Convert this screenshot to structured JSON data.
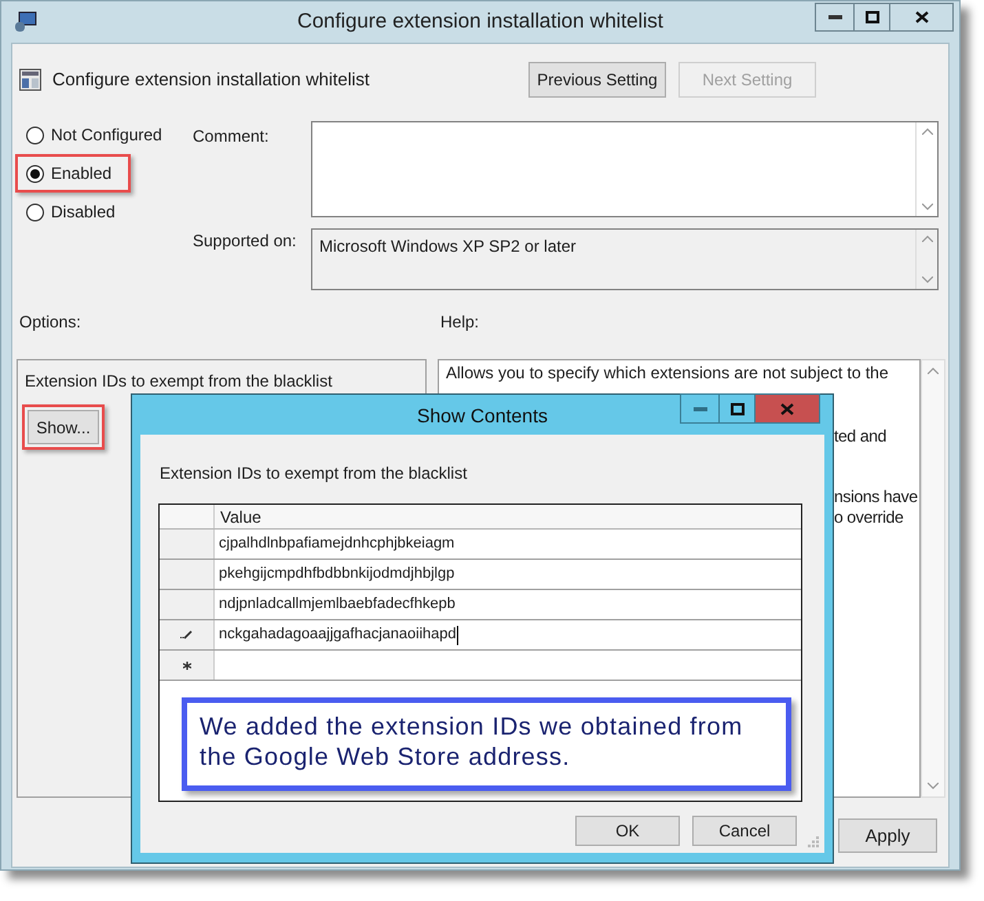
{
  "window": {
    "title": "Configure extension installation whitelist"
  },
  "policy": {
    "name": "Configure extension installation whitelist",
    "buttons": [
      {
        "label": "Previous Setting",
        "disabled": false
      },
      {
        "label": "Next Setting",
        "disabled": true
      }
    ]
  },
  "state_options": [
    {
      "label": "Not Configured",
      "selected": false,
      "highlighted": false
    },
    {
      "label": "Enabled",
      "selected": true,
      "highlighted": true
    },
    {
      "label": "Disabled",
      "selected": false,
      "highlighted": false
    }
  ],
  "comment": {
    "label": "Comment:"
  },
  "supported_on": {
    "label": "Supported on:",
    "value": "Microsoft Windows XP SP2 or later"
  },
  "options": {
    "label": "Options:",
    "text": "Extension IDs to exempt from the blacklist",
    "button": {
      "label": "Show...",
      "highlighted": true
    }
  },
  "help": {
    "label": "Help:",
    "lines": [
      {
        "text": "Allows you to specify which extensions are not subject to the",
        "cut": false
      },
      {
        "text": "ted and",
        "cut": true
      },
      {
        "text": "nsions have",
        "cut": true
      },
      {
        "text": "o override",
        "cut": true
      }
    ]
  },
  "apply_button": {
    "label": "Apply"
  },
  "dialog": {
    "title": "Show Contents",
    "label": "Extension IDs to exempt from the blacklist",
    "column": "Value",
    "rows": [
      {
        "value": "cjpalhdlnbpafiamejdnhcphjbkeiagm",
        "editing": false
      },
      {
        "value": "pkehgijcmpdhfbdbbnkijodmdjhbjlgp",
        "editing": false
      },
      {
        "value": "ndjpnladcallmjemlbaebfadecfhkepb",
        "editing": false
      },
      {
        "value": "nckgahadagoaajjgafhacjanaoiihapd",
        "editing": true
      }
    ],
    "buttons": [
      {
        "label": "OK"
      },
      {
        "label": "Cancel"
      }
    ]
  },
  "callout": {
    "text": "We added the extension IDs we obtained from the Google Web Store address."
  }
}
